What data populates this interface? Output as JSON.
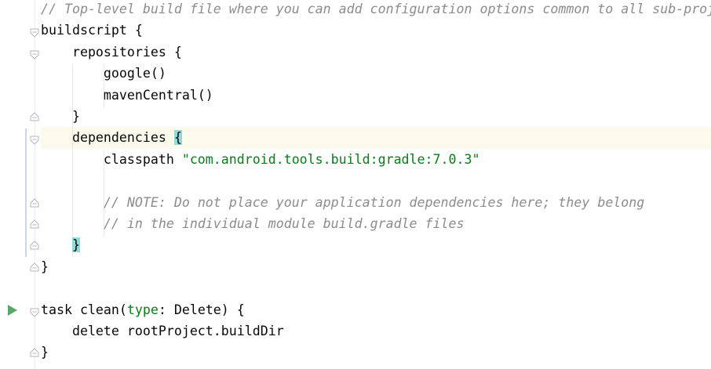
{
  "editor": {
    "lines": [
      {
        "segments": [
          {
            "t": "// Top-level build file where you can add configuration options common to all sub-proj",
            "c": "cmt"
          }
        ]
      },
      {
        "segments": [
          {
            "t": "buildscript {",
            "c": ""
          }
        ]
      },
      {
        "segments": [
          {
            "t": "    repositories {",
            "c": ""
          }
        ]
      },
      {
        "segments": [
          {
            "t": "        google()",
            "c": ""
          }
        ]
      },
      {
        "segments": [
          {
            "t": "        mavenCentral()",
            "c": ""
          }
        ]
      },
      {
        "segments": [
          {
            "t": "    }",
            "c": ""
          }
        ]
      },
      {
        "segments": [
          {
            "t": "    dependencies ",
            "c": ""
          },
          {
            "t": "{",
            "c": "brace-match"
          }
        ]
      },
      {
        "segments": [
          {
            "t": "        classpath ",
            "c": ""
          },
          {
            "t": "\"com.android.tools.build:gradle:7.0.3\"",
            "c": "str"
          }
        ]
      },
      {
        "segments": [
          {
            "t": "",
            "c": ""
          }
        ]
      },
      {
        "segments": [
          {
            "t": "        ",
            "c": ""
          },
          {
            "t": "// NOTE: Do not place your application dependencies here; they belong",
            "c": "cmt"
          }
        ]
      },
      {
        "segments": [
          {
            "t": "        ",
            "c": ""
          },
          {
            "t": "// in the individual module build.gradle files",
            "c": "cmt"
          }
        ]
      },
      {
        "segments": [
          {
            "t": "    ",
            "c": ""
          },
          {
            "t": "}",
            "c": "brace-match"
          }
        ]
      },
      {
        "segments": [
          {
            "t": "}",
            "c": ""
          }
        ]
      },
      {
        "segments": [
          {
            "t": "",
            "c": ""
          }
        ]
      },
      {
        "segments": [
          {
            "t": "task clean(",
            "c": ""
          },
          {
            "t": "type",
            "c": "kwarg"
          },
          {
            "t": ": Delete) {",
            "c": ""
          }
        ]
      },
      {
        "segments": [
          {
            "t": "    delete rootProject.buildDir",
            "c": ""
          }
        ]
      },
      {
        "segments": [
          {
            "t": "}",
            "c": ""
          }
        ]
      }
    ],
    "current_line": 6,
    "run_line": 14,
    "fold_open_lines": [
      1,
      2,
      6,
      14
    ],
    "fold_close_lines": [
      5,
      9,
      10,
      11,
      12,
      16
    ],
    "accent_current_line": "#fcfaed",
    "accent_brace_match": "#93d9d9",
    "icons": {
      "run": "run-triangle-icon",
      "fold_open": "fold-expanded-icon",
      "fold_close": "fold-end-icon"
    }
  }
}
